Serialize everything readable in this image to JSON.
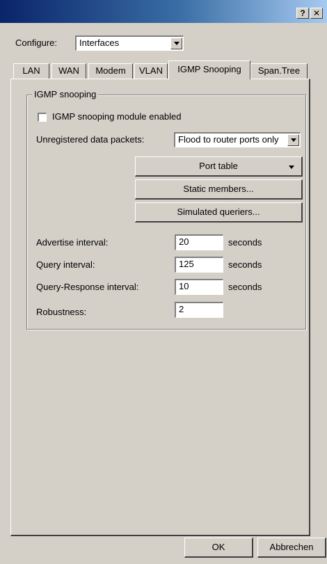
{
  "window": {
    "help_label": "?",
    "close_label": "✕"
  },
  "configure": {
    "label": "Configure:",
    "value": "Interfaces"
  },
  "tabs": [
    {
      "label": "LAN"
    },
    {
      "label": "WAN"
    },
    {
      "label": "Modem"
    },
    {
      "label": "VLAN"
    },
    {
      "label": "IGMP Snooping",
      "active": true
    },
    {
      "label": "Span.Tree"
    }
  ],
  "group": {
    "title": "IGMP snooping",
    "module_enabled_label": "IGMP snooping module enabled",
    "module_enabled": false,
    "unregistered_label": "Unregistered data packets:",
    "unregistered_value": "Flood to router ports only",
    "port_table_label": "Port table",
    "static_members_label": "Static members...",
    "simulated_queriers_label": "Simulated queriers...",
    "fields": [
      {
        "label": "Advertise interval:",
        "value": "20",
        "unit": "seconds"
      },
      {
        "label": "Query interval:",
        "value": "125",
        "unit": "seconds"
      },
      {
        "label": "Query-Response interval:",
        "value": "10",
        "unit": "seconds"
      },
      {
        "label": "Robustness:",
        "value": "2",
        "unit": ""
      }
    ]
  },
  "footer": {
    "ok_label": "OK",
    "cancel_label": "Abbrechen"
  },
  "colors": {
    "titlebar_start": "#0a246a",
    "titlebar_end": "#a6caf0",
    "face": "#d4d0c8"
  }
}
